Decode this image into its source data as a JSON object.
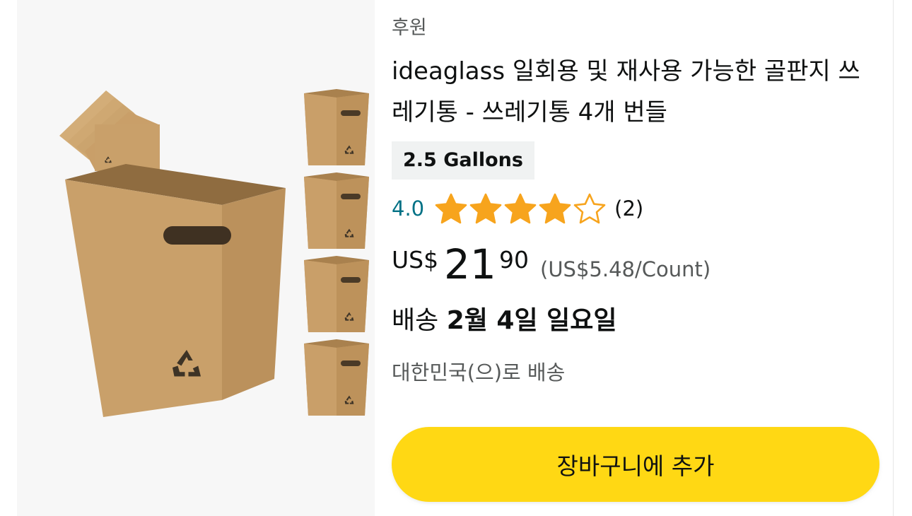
{
  "product": {
    "sponsored_label": "후원",
    "title": "ideaglass 일회용 및 재사용 가능한 골판지 쓰레기통 - 쓰레기통 4개 번들",
    "variant_badge": "2.5 Gallons",
    "image_icon": "recycle-icon",
    "rating": {
      "value_text": "4.0",
      "value": 4.0,
      "out_of": 5,
      "review_count_text": "(2)"
    },
    "price": {
      "currency": "US$",
      "whole": "21",
      "fraction": "90",
      "unit_price": "(US$5.48/Count)"
    },
    "delivery": {
      "prefix": "배송",
      "date": "2월 4일 일요일"
    },
    "ship_to": "대한민국(으)로 배송",
    "add_to_cart_label": "장바구니에 추가"
  },
  "colors": {
    "accent_button": "#ffd814",
    "star": "#f7a41d",
    "rating_link": "#007185",
    "secondary_text": "#565959",
    "badge_bg": "#f0f2f2"
  }
}
